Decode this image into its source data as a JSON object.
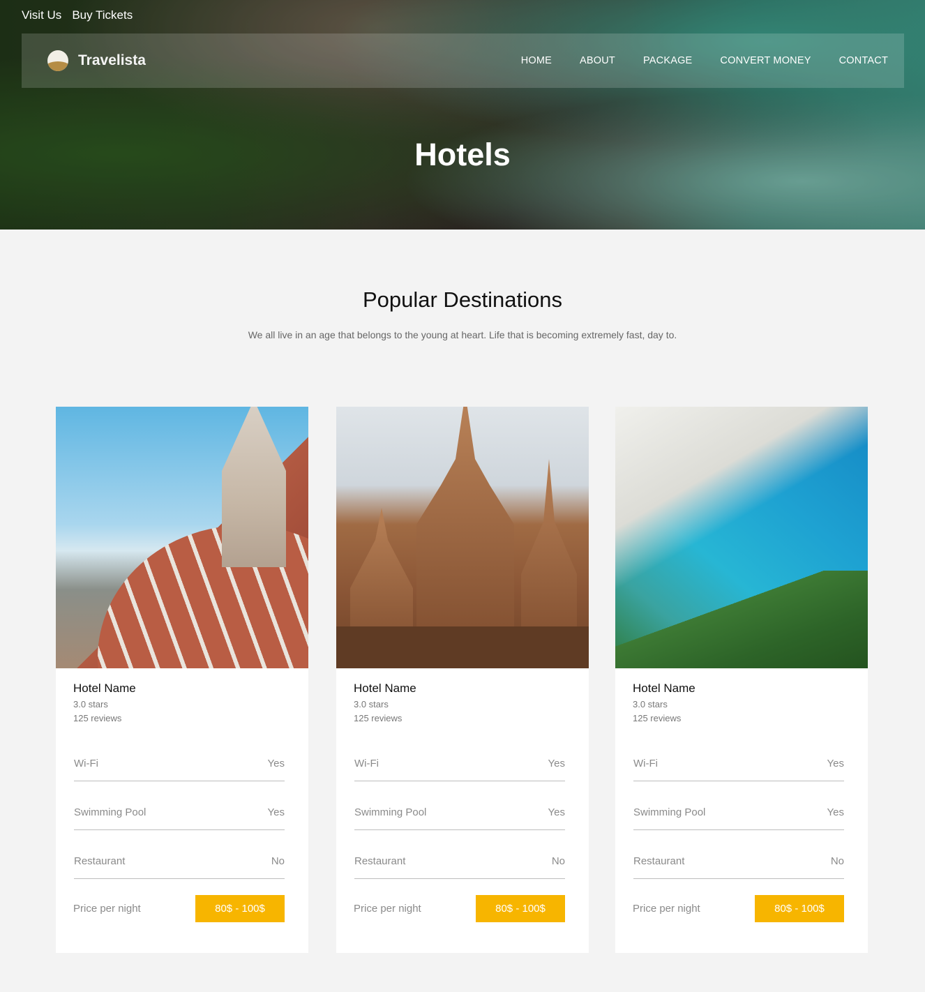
{
  "topbar": {
    "visit": "Visit Us",
    "tickets": "Buy Tickets"
  },
  "nav": {
    "brand": "Travelista",
    "items": [
      "HOME",
      "ABOUT",
      "PACKAGE",
      "CONVERT MONEY",
      "CONTACT"
    ]
  },
  "hero": {
    "title": "Hotels"
  },
  "section": {
    "title": "Popular Destinations",
    "subtitle": "We all live in an age that belongs to the young at heart. Life that is becoming extremely fast, day to."
  },
  "cards": [
    {
      "name": "Hotel Name",
      "stars": "3.0 stars",
      "reviews": "125 reviews",
      "features": [
        {
          "label": "Wi-Fi",
          "value": "Yes"
        },
        {
          "label": "Swimming Pool",
          "value": "Yes"
        },
        {
          "label": "Restaurant",
          "value": "No"
        }
      ],
      "price_label": "Price per night",
      "price": "80$ - 100$"
    },
    {
      "name": "Hotel Name",
      "stars": "3.0 stars",
      "reviews": "125 reviews",
      "features": [
        {
          "label": "Wi-Fi",
          "value": "Yes"
        },
        {
          "label": "Swimming Pool",
          "value": "Yes"
        },
        {
          "label": "Restaurant",
          "value": "No"
        }
      ],
      "price_label": "Price per night",
      "price": "80$ - 100$"
    },
    {
      "name": "Hotel Name",
      "stars": "3.0 stars",
      "reviews": "125 reviews",
      "features": [
        {
          "label": "Wi-Fi",
          "value": "Yes"
        },
        {
          "label": "Swimming Pool",
          "value": "Yes"
        },
        {
          "label": "Restaurant",
          "value": "No"
        }
      ],
      "price_label": "Price per night",
      "price": "80$ - 100$"
    }
  ],
  "colors": {
    "accent": "#f7b500",
    "page_bg": "#f3f3f3"
  }
}
